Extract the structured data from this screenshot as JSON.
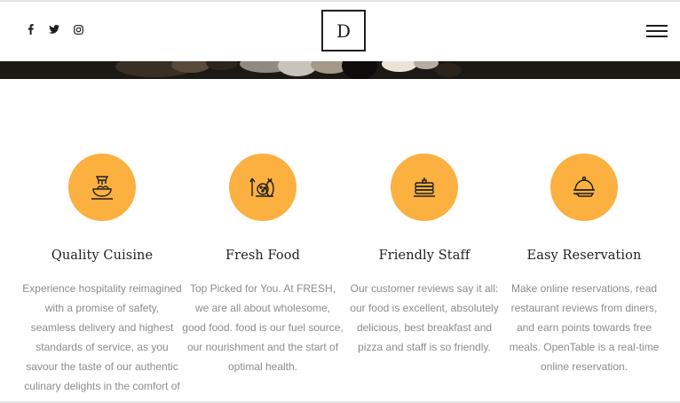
{
  "header": {
    "logo_letter": "D",
    "social": [
      "facebook-icon",
      "twitter-icon",
      "instagram-icon"
    ],
    "menu_icon": "hamburger-menu-icon"
  },
  "colors": {
    "accent": "#fbb040",
    "text_dark": "#222222",
    "text_muted": "#8c8c8c"
  },
  "features": [
    {
      "icon": "food-bowl-icon",
      "title": "Quality Cuisine",
      "text": "Experience hospitality reimagined with a promise of safety, seamless delivery and highest standards of service, as you savour the taste of our authentic culinary delights in the comfort of"
    },
    {
      "icon": "fresh-food-icon",
      "title": "Fresh Food",
      "text": "Top Picked for You. At FRESH, we are all about wholesome, good food. food is our fuel source, our nourishment and the start of optimal health."
    },
    {
      "icon": "pancake-stack-icon",
      "title": "Friendly Staff",
      "text": "Our customer reviews say it all: our food is excellent, absolutely delicious, best breakfast and pizza and staff is so friendly."
    },
    {
      "icon": "serving-cloche-icon",
      "title": "Easy Reservation",
      "text": "Make online reservations, read restaurant reviews from diners, and earn points towards free meals. OpenTable is a real-time online reservation."
    }
  ]
}
